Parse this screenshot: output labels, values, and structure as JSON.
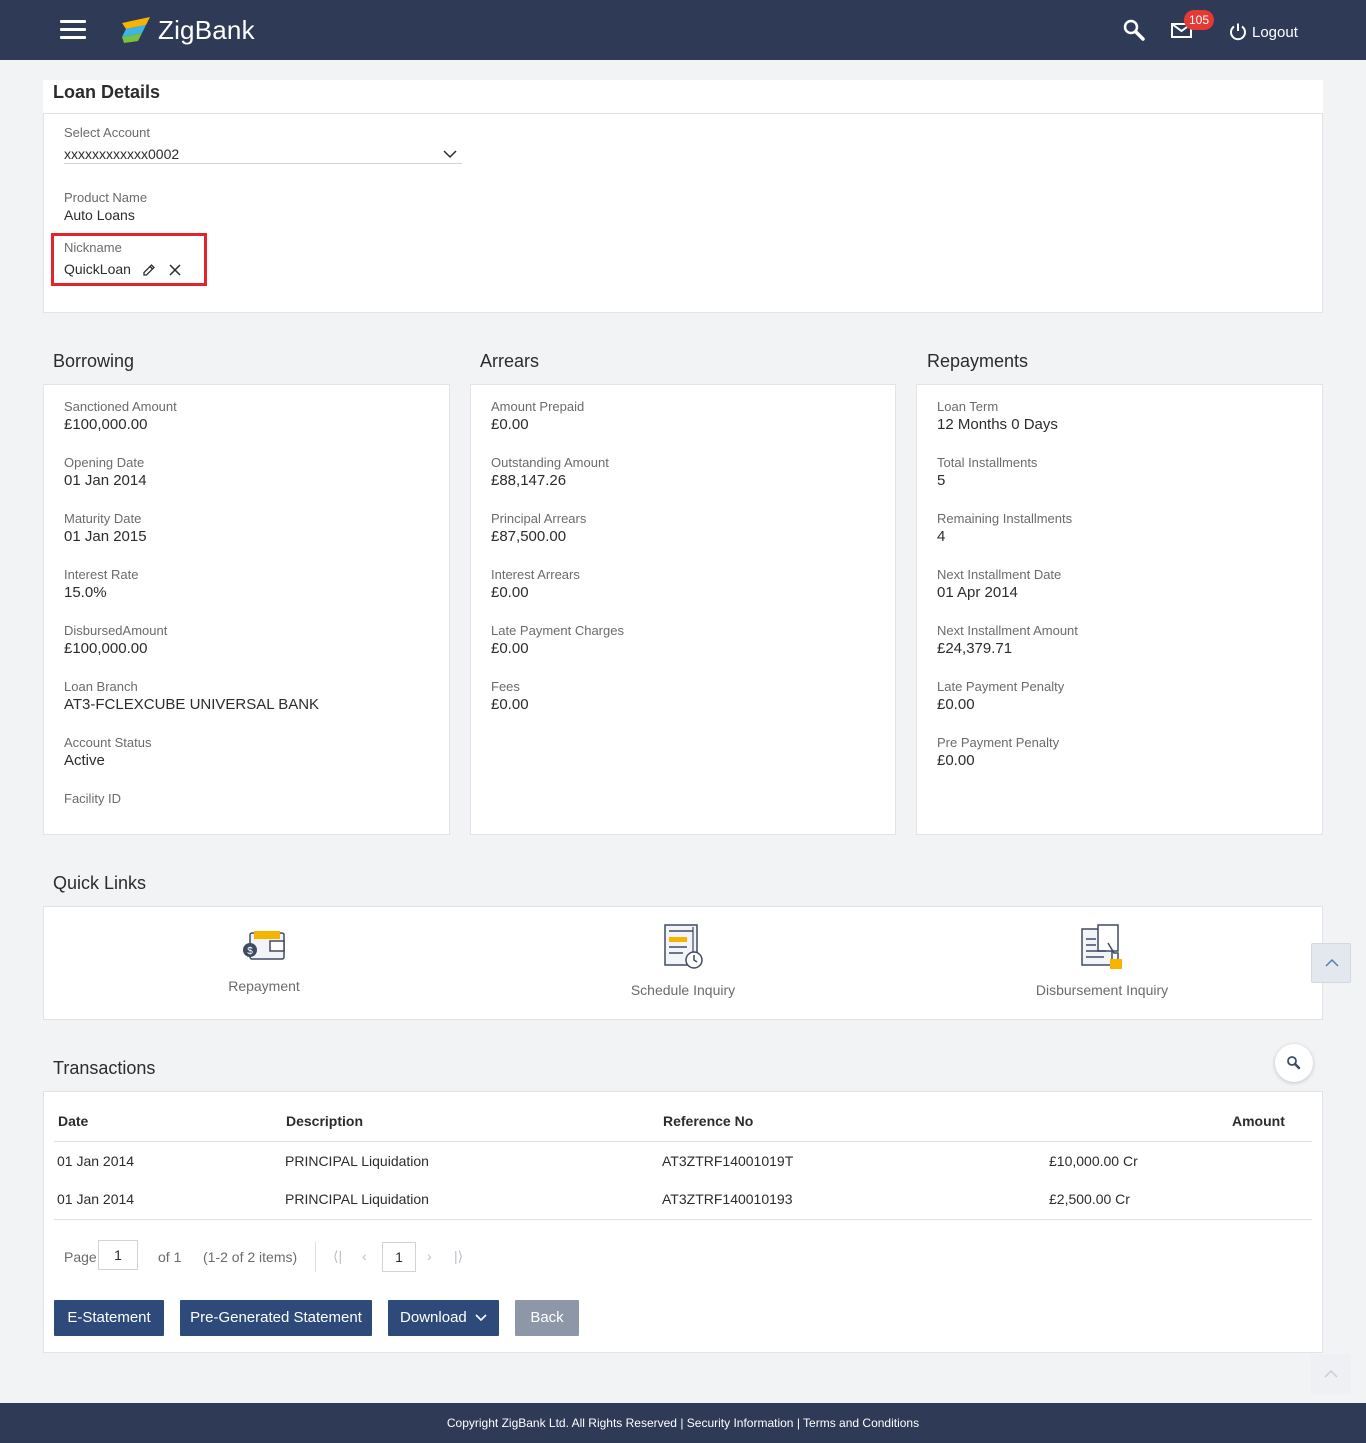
{
  "header": {
    "brand": "ZigBank",
    "notification_count": "105",
    "logout_label": "Logout"
  },
  "loan_details": {
    "title": "Loan Details",
    "select_account_label": "Select Account",
    "select_account_value": "xxxxxxxxxxxx0002",
    "product_name_label": "Product Name",
    "product_name_value": "Auto Loans",
    "nickname_label": "Nickname",
    "nickname_value": "QuickLoan"
  },
  "borrowing": {
    "title": "Borrowing",
    "fields": [
      {
        "label": "Sanctioned Amount",
        "value": "£100,000.00"
      },
      {
        "label": "Opening Date",
        "value": "01 Jan 2014"
      },
      {
        "label": "Maturity Date",
        "value": "01 Jan 2015"
      },
      {
        "label": "Interest Rate",
        "value": "15.0%"
      },
      {
        "label": "DisbursedAmount",
        "value": "£100,000.00"
      },
      {
        "label": "Loan Branch",
        "value": "AT3-FCLEXCUBE UNIVERSAL BANK"
      },
      {
        "label": "Account Status",
        "value": "Active"
      },
      {
        "label": "Facility ID",
        "value": ""
      }
    ]
  },
  "arrears": {
    "title": "Arrears",
    "fields": [
      {
        "label": "Amount Prepaid",
        "value": "£0.00"
      },
      {
        "label": "Outstanding Amount",
        "value": "£88,147.26"
      },
      {
        "label": "Principal Arrears",
        "value": "£87,500.00"
      },
      {
        "label": "Interest Arrears",
        "value": "£0.00"
      },
      {
        "label": "Late Payment Charges",
        "value": "£0.00"
      },
      {
        "label": "Fees",
        "value": "£0.00"
      }
    ]
  },
  "repayments": {
    "title": "Repayments",
    "fields": [
      {
        "label": "Loan Term",
        "value": "12 Months 0 Days"
      },
      {
        "label": "Total Installments",
        "value": "5"
      },
      {
        "label": "Remaining Installments",
        "value": "4"
      },
      {
        "label": "Next Installment Date",
        "value": "01 Apr 2014"
      },
      {
        "label": "Next Installment Amount",
        "value": "£24,379.71"
      },
      {
        "label": "Late Payment Penalty",
        "value": "£0.00"
      },
      {
        "label": "Pre Payment Penalty",
        "value": "£0.00"
      }
    ]
  },
  "quick_links": {
    "title": "Quick Links",
    "items": [
      {
        "label": "Repayment",
        "icon": "wallet-icon"
      },
      {
        "label": "Schedule Inquiry",
        "icon": "schedule-icon"
      },
      {
        "label": "Disbursement Inquiry",
        "icon": "disbursement-icon"
      }
    ]
  },
  "transactions": {
    "title": "Transactions",
    "columns": [
      "Date",
      "Description",
      "Reference No",
      "Amount"
    ],
    "rows": [
      {
        "date": "01 Jan 2014",
        "description": "PRINCIPAL Liquidation",
        "reference": "AT3ZTRF14001019T",
        "amount": "£10,000.00 Cr"
      },
      {
        "date": "01 Jan 2014",
        "description": "PRINCIPAL Liquidation",
        "reference": "AT3ZTRF140010193",
        "amount": "£2,500.00 Cr"
      }
    ],
    "pagination": {
      "page_label": "Page",
      "page_value": "1",
      "of_label": "of 1",
      "items_label": "(1-2 of 2 items)",
      "current_page": "1"
    },
    "buttons": {
      "estatement": "E-Statement",
      "pregenerated": "Pre-Generated Statement",
      "download": "Download",
      "back": "Back"
    }
  },
  "footer": {
    "text": "Copyright ZigBank Ltd. All Rights Reserved | Security Information | Terms and Conditions"
  },
  "colors": {
    "header_bg": "#2e3a56",
    "button_primary": "#2e4a7a",
    "button_secondary": "#8d97a8",
    "highlight_border": "#e3242b",
    "badge": "#e53935"
  }
}
